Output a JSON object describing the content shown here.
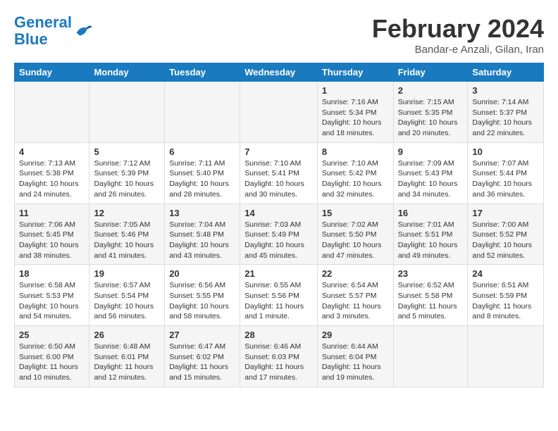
{
  "header": {
    "logo_line1": "General",
    "logo_line2": "Blue",
    "month_year": "February 2024",
    "location": "Bandar-e Anzali, Gilan, Iran"
  },
  "days_of_week": [
    "Sunday",
    "Monday",
    "Tuesday",
    "Wednesday",
    "Thursday",
    "Friday",
    "Saturday"
  ],
  "weeks": [
    [
      {
        "day": "",
        "info": ""
      },
      {
        "day": "",
        "info": ""
      },
      {
        "day": "",
        "info": ""
      },
      {
        "day": "",
        "info": ""
      },
      {
        "day": "1",
        "info": "Sunrise: 7:16 AM\nSunset: 5:34 PM\nDaylight: 10 hours\nand 18 minutes."
      },
      {
        "day": "2",
        "info": "Sunrise: 7:15 AM\nSunset: 5:35 PM\nDaylight: 10 hours\nand 20 minutes."
      },
      {
        "day": "3",
        "info": "Sunrise: 7:14 AM\nSunset: 5:37 PM\nDaylight: 10 hours\nand 22 minutes."
      }
    ],
    [
      {
        "day": "4",
        "info": "Sunrise: 7:13 AM\nSunset: 5:38 PM\nDaylight: 10 hours\nand 24 minutes."
      },
      {
        "day": "5",
        "info": "Sunrise: 7:12 AM\nSunset: 5:39 PM\nDaylight: 10 hours\nand 26 minutes."
      },
      {
        "day": "6",
        "info": "Sunrise: 7:11 AM\nSunset: 5:40 PM\nDaylight: 10 hours\nand 28 minutes."
      },
      {
        "day": "7",
        "info": "Sunrise: 7:10 AM\nSunset: 5:41 PM\nDaylight: 10 hours\nand 30 minutes."
      },
      {
        "day": "8",
        "info": "Sunrise: 7:10 AM\nSunset: 5:42 PM\nDaylight: 10 hours\nand 32 minutes."
      },
      {
        "day": "9",
        "info": "Sunrise: 7:09 AM\nSunset: 5:43 PM\nDaylight: 10 hours\nand 34 minutes."
      },
      {
        "day": "10",
        "info": "Sunrise: 7:07 AM\nSunset: 5:44 PM\nDaylight: 10 hours\nand 36 minutes."
      }
    ],
    [
      {
        "day": "11",
        "info": "Sunrise: 7:06 AM\nSunset: 5:45 PM\nDaylight: 10 hours\nand 38 minutes."
      },
      {
        "day": "12",
        "info": "Sunrise: 7:05 AM\nSunset: 5:46 PM\nDaylight: 10 hours\nand 41 minutes."
      },
      {
        "day": "13",
        "info": "Sunrise: 7:04 AM\nSunset: 5:48 PM\nDaylight: 10 hours\nand 43 minutes."
      },
      {
        "day": "14",
        "info": "Sunrise: 7:03 AM\nSunset: 5:49 PM\nDaylight: 10 hours\nand 45 minutes."
      },
      {
        "day": "15",
        "info": "Sunrise: 7:02 AM\nSunset: 5:50 PM\nDaylight: 10 hours\nand 47 minutes."
      },
      {
        "day": "16",
        "info": "Sunrise: 7:01 AM\nSunset: 5:51 PM\nDaylight: 10 hours\nand 49 minutes."
      },
      {
        "day": "17",
        "info": "Sunrise: 7:00 AM\nSunset: 5:52 PM\nDaylight: 10 hours\nand 52 minutes."
      }
    ],
    [
      {
        "day": "18",
        "info": "Sunrise: 6:58 AM\nSunset: 5:53 PM\nDaylight: 10 hours\nand 54 minutes."
      },
      {
        "day": "19",
        "info": "Sunrise: 6:57 AM\nSunset: 5:54 PM\nDaylight: 10 hours\nand 56 minutes."
      },
      {
        "day": "20",
        "info": "Sunrise: 6:56 AM\nSunset: 5:55 PM\nDaylight: 10 hours\nand 58 minutes."
      },
      {
        "day": "21",
        "info": "Sunrise: 6:55 AM\nSunset: 5:56 PM\nDaylight: 11 hours\nand 1 minute."
      },
      {
        "day": "22",
        "info": "Sunrise: 6:54 AM\nSunset: 5:57 PM\nDaylight: 11 hours\nand 3 minutes."
      },
      {
        "day": "23",
        "info": "Sunrise: 6:52 AM\nSunset: 5:58 PM\nDaylight: 11 hours\nand 5 minutes."
      },
      {
        "day": "24",
        "info": "Sunrise: 6:51 AM\nSunset: 5:59 PM\nDaylight: 11 hours\nand 8 minutes."
      }
    ],
    [
      {
        "day": "25",
        "info": "Sunrise: 6:50 AM\nSunset: 6:00 PM\nDaylight: 11 hours\nand 10 minutes."
      },
      {
        "day": "26",
        "info": "Sunrise: 6:48 AM\nSunset: 6:01 PM\nDaylight: 11 hours\nand 12 minutes."
      },
      {
        "day": "27",
        "info": "Sunrise: 6:47 AM\nSunset: 6:02 PM\nDaylight: 11 hours\nand 15 minutes."
      },
      {
        "day": "28",
        "info": "Sunrise: 6:46 AM\nSunset: 6:03 PM\nDaylight: 11 hours\nand 17 minutes."
      },
      {
        "day": "29",
        "info": "Sunrise: 6:44 AM\nSunset: 6:04 PM\nDaylight: 11 hours\nand 19 minutes."
      },
      {
        "day": "",
        "info": ""
      },
      {
        "day": "",
        "info": ""
      }
    ]
  ]
}
